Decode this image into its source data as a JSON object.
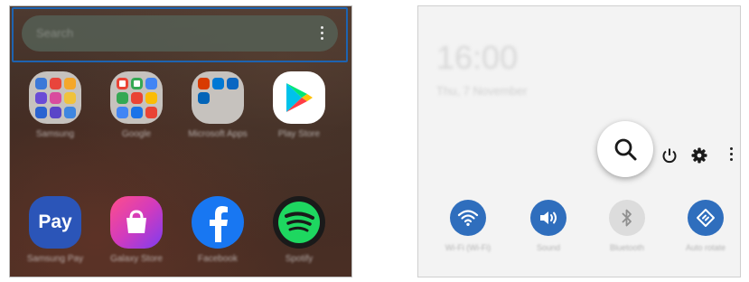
{
  "home_screen": {
    "search_placeholder": "Search",
    "apps": [
      {
        "label": "Samsung"
      },
      {
        "label": "Google"
      },
      {
        "label": "Microsoft Apps"
      },
      {
        "label": "Play Store"
      },
      {
        "label": "Samsung Pay",
        "icon_text": "Pay"
      },
      {
        "label": "Galaxy Store"
      },
      {
        "label": "Facebook"
      },
      {
        "label": "Spotify"
      }
    ]
  },
  "notification_panel": {
    "time": "16:00",
    "date": "Thu, 7 November",
    "toggles": [
      {
        "label": "Wi-Fi (Wi-Fi)",
        "icon": "wifi-icon",
        "active": true
      },
      {
        "label": "Sound",
        "icon": "sound-icon",
        "active": true
      },
      {
        "label": "Bluetooth",
        "icon": "bluetooth-icon",
        "active": false
      },
      {
        "label": "Auto rotate",
        "icon": "auto-rotate-icon",
        "active": true
      }
    ]
  },
  "colors": {
    "highlight": "#1e63b0",
    "toggle_active": "#2f6ebd",
    "toggle_inactive": "#dcdcdc"
  }
}
